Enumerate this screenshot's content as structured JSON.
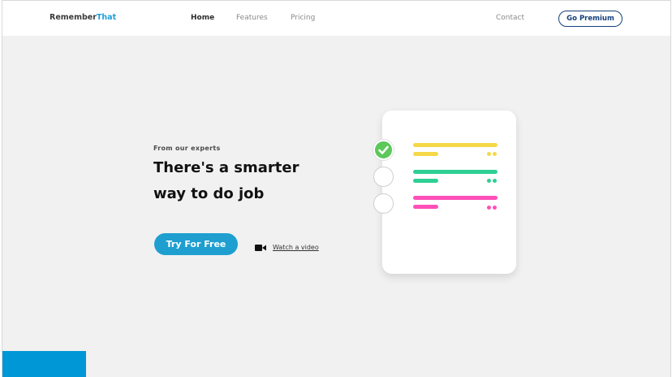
{
  "brand": {
    "name_main": "Remember",
    "name_accent": "That"
  },
  "nav": {
    "home": "Home",
    "features": "Features",
    "pricing": "Pricing",
    "contact": "Contact",
    "premium_label": "Go Premium"
  },
  "hero": {
    "eyebrow": "From our experts",
    "headline": "There's a smarter way to do job",
    "cta_label": "Try For Free",
    "video_label": "Watch a video"
  },
  "illustration": {
    "tasks": [
      {
        "done": true,
        "color": "#f5d849"
      },
      {
        "done": false,
        "color": "#2fcf95"
      },
      {
        "done": false,
        "color": "#ff4fb8"
      }
    ]
  },
  "colors": {
    "accent": "#1d9fd6",
    "premium": "#14407a",
    "cta": "#1e9fd0",
    "check": "#5cc85a",
    "bottom_block": "#0097d6"
  }
}
